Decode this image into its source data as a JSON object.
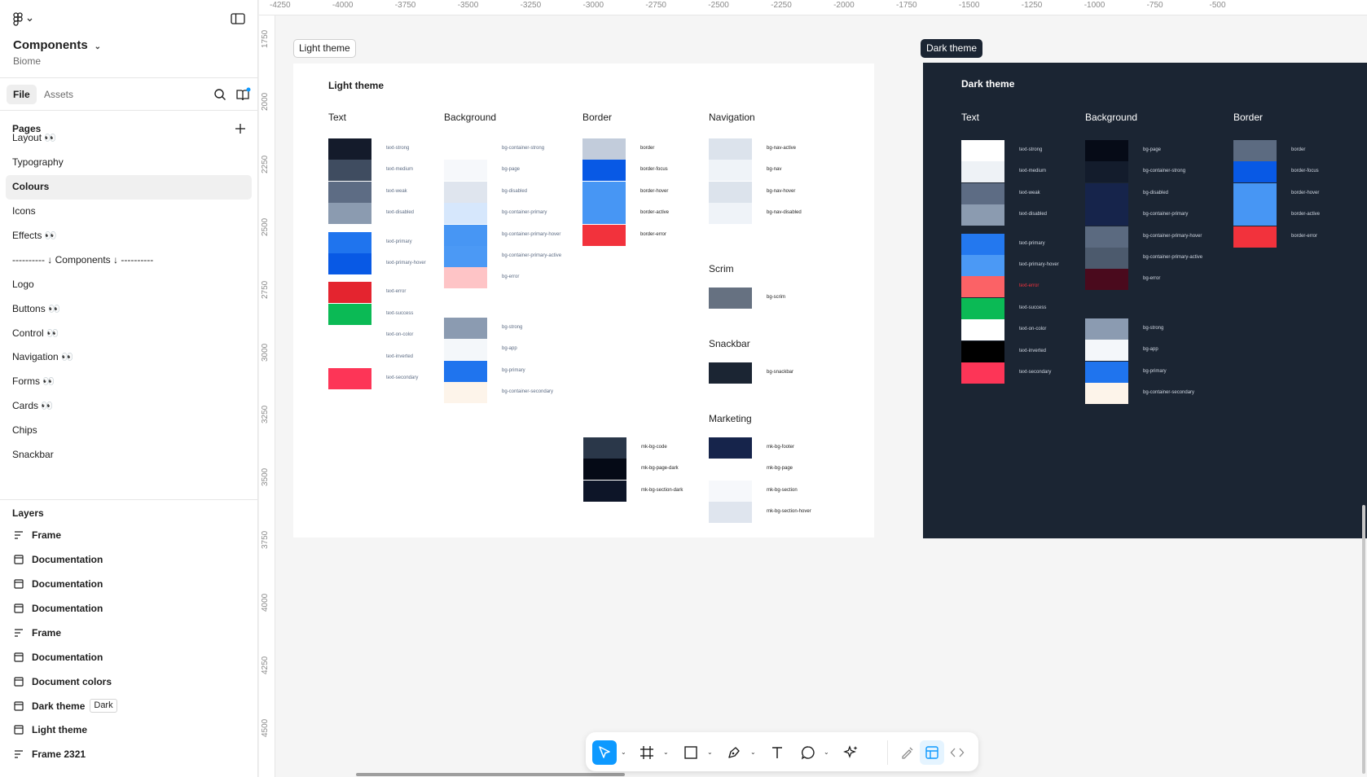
{
  "sidebar": {
    "file_title": "Components",
    "file_subtitle": "Biome",
    "tabs": {
      "file": "File",
      "assets": "Assets"
    },
    "pages_title": "Pages",
    "pages": [
      {
        "label": "Layout 👀",
        "active": false
      },
      {
        "label": "Typography",
        "active": false
      },
      {
        "label": "Colours",
        "active": true
      },
      {
        "label": "Icons",
        "active": false
      },
      {
        "label": "Effects 👀",
        "active": false
      },
      {
        "label": "---------- ↓ Components ↓ ----------",
        "active": false
      },
      {
        "label": "Logo",
        "active": false
      },
      {
        "label": "Buttons 👀",
        "active": false
      },
      {
        "label": "Control 👀",
        "active": false
      },
      {
        "label": "Navigation 👀",
        "active": false
      },
      {
        "label": "Forms 👀",
        "active": false
      },
      {
        "label": "Cards 👀",
        "active": false
      },
      {
        "label": "Chips",
        "active": false
      },
      {
        "label": "Snackbar",
        "active": false
      }
    ],
    "layers_title": "Layers",
    "layers": [
      {
        "label": "Frame",
        "icon": "frame-icon",
        "tag": ""
      },
      {
        "label": "Documentation",
        "icon": "component-icon",
        "tag": ""
      },
      {
        "label": "Documentation",
        "icon": "component-icon",
        "tag": ""
      },
      {
        "label": "Documentation",
        "icon": "component-icon",
        "tag": ""
      },
      {
        "label": "Frame",
        "icon": "frame-icon",
        "tag": ""
      },
      {
        "label": "Documentation",
        "icon": "component-icon",
        "tag": ""
      },
      {
        "label": "Document colors",
        "icon": "component-icon",
        "tag": ""
      },
      {
        "label": "Dark theme",
        "icon": "component-icon",
        "tag": "Dark"
      },
      {
        "label": "Light theme",
        "icon": "component-icon",
        "tag": ""
      },
      {
        "label": "Frame 2321",
        "icon": "frame-icon",
        "tag": ""
      }
    ]
  },
  "rulers": {
    "top": [
      "-4250",
      "-4000",
      "-3750",
      "-3500",
      "-3250",
      "-3000",
      "-2750",
      "-2500",
      "-2250",
      "-2000",
      "-1750",
      "-1500",
      "-1250",
      "-1000",
      "-750",
      "-500"
    ],
    "left": [
      "1750",
      "2000",
      "2250",
      "2500",
      "2750",
      "3000",
      "3250",
      "3500",
      "3750",
      "4000",
      "4250",
      "4500"
    ]
  },
  "light": {
    "label": "Light theme",
    "title": "Light theme",
    "groups": {
      "text": "Text",
      "background": "Background",
      "border": "Border",
      "navigation": "Navigation",
      "scrim": "Scrim",
      "snackbar": "Snackbar",
      "marketing": "Marketing"
    },
    "text_swatches": [
      {
        "name": "text-strong",
        "color": "#141b2b"
      },
      {
        "name": "text-medium",
        "color": "#3f4c60"
      },
      {
        "name": "text-weak",
        "color": "#5d6c84"
      },
      {
        "name": "text-disabled",
        "color": "#8b9bb0"
      },
      {
        "name": "text-primary",
        "color": "#1f74ee"
      },
      {
        "name": "text-primary-hover",
        "color": "#0859e5"
      },
      {
        "name": "text-error",
        "color": "#e4242f"
      },
      {
        "name": "text-success",
        "color": "#0bba55"
      },
      {
        "name": "text-on-color",
        "color": "#ffffff"
      },
      {
        "name": "text-inverted",
        "color": "#ffffff"
      },
      {
        "name": "text-secondary",
        "color": "#fd3557"
      }
    ],
    "bg_swatches": [
      {
        "name": "bg-container-strong",
        "color": "#ffffff"
      },
      {
        "name": "bg-page",
        "color": "#f6f8fb"
      },
      {
        "name": "bg-disabled",
        "color": "#dfe5ee"
      },
      {
        "name": "bg-container-primary",
        "color": "#d6e7fc"
      },
      {
        "name": "bg-container-primary-hover",
        "color": "#4796f4"
      },
      {
        "name": "bg-container-primary-active",
        "color": "#4b99f5"
      },
      {
        "name": "bg-error",
        "color": "#fec4c6"
      }
    ],
    "bg_swatches2": [
      {
        "name": "bg-strong",
        "color": "#8b9bb1"
      },
      {
        "name": "bg-app",
        "color": "#f4f7fa"
      },
      {
        "name": "bg-primary",
        "color": "#1f74ee"
      },
      {
        "name": "bg-container-secondary",
        "color": "#fdf4ea"
      }
    ],
    "border_swatches": [
      {
        "name": "border",
        "color": "#c2ccdb"
      },
      {
        "name": "border-focus",
        "color": "#0859e5"
      },
      {
        "name": "border-hover",
        "color": "#4796f4"
      },
      {
        "name": "border-active",
        "color": "#4796f4"
      },
      {
        "name": "border-error",
        "color": "#f2323c"
      }
    ],
    "nav_swatches": [
      {
        "name": "bg-nav-active",
        "color": "#dce3ec"
      },
      {
        "name": "bg-nav",
        "color": "#eff3f8"
      },
      {
        "name": "bg-nav-hover",
        "color": "#dce3ec"
      },
      {
        "name": "bg-nav-disabled",
        "color": "#eff3f8"
      }
    ],
    "scrim_swatches": [
      {
        "name": "bg-scrim",
        "color": "#667181"
      }
    ],
    "snackbar_swatches": [
      {
        "name": "bg-snackbar",
        "color": "#1b2533"
      }
    ],
    "mk_swatches_left": [
      {
        "name": "mk-bg-code",
        "color": "#2a3749"
      },
      {
        "name": "mk-bg-page-dark",
        "color": "#050a16"
      },
      {
        "name": "mk-bg-section-dark",
        "color": "#0d1528"
      }
    ],
    "mk_swatches_right": [
      {
        "name": "mk-bg-footer",
        "color": "#16244b"
      },
      {
        "name": "mk-bg-page",
        "color": "#ffffff"
      },
      {
        "name": "mk-bg-section",
        "color": "#f6f8fb"
      },
      {
        "name": "mk-bg-section-hover",
        "color": "#dfe5ee"
      }
    ]
  },
  "dark": {
    "label": "Dark theme",
    "title": "Dark theme",
    "groups": {
      "text": "Text",
      "background": "Background",
      "border": "Border"
    },
    "text_swatches": [
      {
        "name": "text-strong",
        "color": "#ffffff"
      },
      {
        "name": "text-medium",
        "color": "#eef2f6"
      },
      {
        "name": "text-weak",
        "color": "#5d6c84"
      },
      {
        "name": "text-disabled",
        "color": "#8b9bb0"
      },
      {
        "name": "text-primary",
        "color": "#2378ef"
      },
      {
        "name": "text-primary-hover",
        "color": "#4b99f5"
      },
      {
        "name": "text-error",
        "color": "#fb6266"
      },
      {
        "name": "text-success",
        "color": "#0bba55"
      },
      {
        "name": "text-on-color",
        "color": "#ffffff"
      },
      {
        "name": "text-inverted",
        "color": "#000000"
      },
      {
        "name": "text-secondary",
        "color": "#fd3557"
      }
    ],
    "bg_swatches": [
      {
        "name": "bg-page",
        "color": "#060b17"
      },
      {
        "name": "bg-container-strong",
        "color": "#131c2c"
      },
      {
        "name": "bg-disabled",
        "color": "#16244b"
      },
      {
        "name": "bg-container-primary",
        "color": "#16244b"
      },
      {
        "name": "bg-container-primary-hover",
        "color": "#5b6a80"
      },
      {
        "name": "bg-container-primary-active",
        "color": "#4c5a6d"
      },
      {
        "name": "bg-error",
        "color": "#4a0a1d"
      }
    ],
    "bg_swatches2": [
      {
        "name": "bg-strong",
        "color": "#8b9bb1"
      },
      {
        "name": "bg-app",
        "color": "#f4f7fa"
      },
      {
        "name": "bg-primary",
        "color": "#1f74ee"
      },
      {
        "name": "bg-container-secondary",
        "color": "#fdf4ea"
      }
    ],
    "border_swatches": [
      {
        "name": "border",
        "color": "#5c6b81"
      },
      {
        "name": "border-focus",
        "color": "#0859e5"
      },
      {
        "name": "border-hover",
        "color": "#4796f4"
      },
      {
        "name": "border-active",
        "color": "#4796f4"
      },
      {
        "name": "border-error",
        "color": "#f2323c"
      }
    ]
  },
  "toolbar": {
    "tools": [
      "move-tool-icon",
      "frame-tool-icon",
      "rectangle-tool-icon",
      "pen-tool-icon",
      "text-tool-icon",
      "comment-tool-icon",
      "ai-actions-icon",
      "draw-mode-icon",
      "design-mode-icon",
      "dev-mode-icon"
    ],
    "accent": "#0d99ff"
  }
}
